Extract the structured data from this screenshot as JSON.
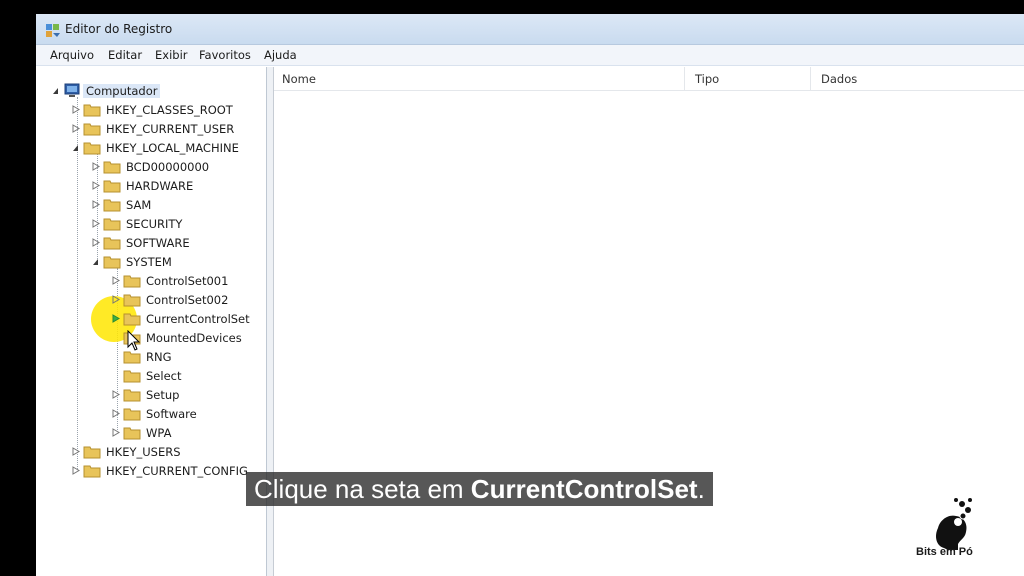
{
  "window": {
    "title": "Editor do Registro",
    "icon": "regedit-icon"
  },
  "menu": [
    "Arquivo",
    "Editar",
    "Exibir",
    "Favoritos",
    "Ajuda"
  ],
  "tree": {
    "root": "Computador",
    "hives": [
      "HKEY_CLASSES_ROOT",
      "HKEY_CURRENT_USER",
      "HKEY_LOCAL_MACHINE"
    ],
    "local_machine_children": [
      "BCD00000000",
      "HARDWARE",
      "SAM",
      "SECURITY",
      "SOFTWARE",
      "SYSTEM"
    ],
    "system_children": [
      "ControlSet001",
      "ControlSet002",
      "CurrentControlSet",
      "MountedDevices",
      "RNG",
      "Select",
      "Setup",
      "Software",
      "WPA"
    ],
    "hives_after": [
      "HKEY_USERS",
      "HKEY_CURRENT_CONFIG"
    ]
  },
  "columns": [
    "Nome",
    "Tipo",
    "Dados"
  ],
  "subtitle": {
    "prefix": "Clique na seta em ",
    "emphasis": "CurrentControlSet",
    "suffix": "."
  },
  "logo": {
    "text": "Bits em Pó"
  },
  "colors": {
    "highlight": "#ffe600",
    "folder": "#e8c45a",
    "selection_arrow": "#3cb043"
  }
}
